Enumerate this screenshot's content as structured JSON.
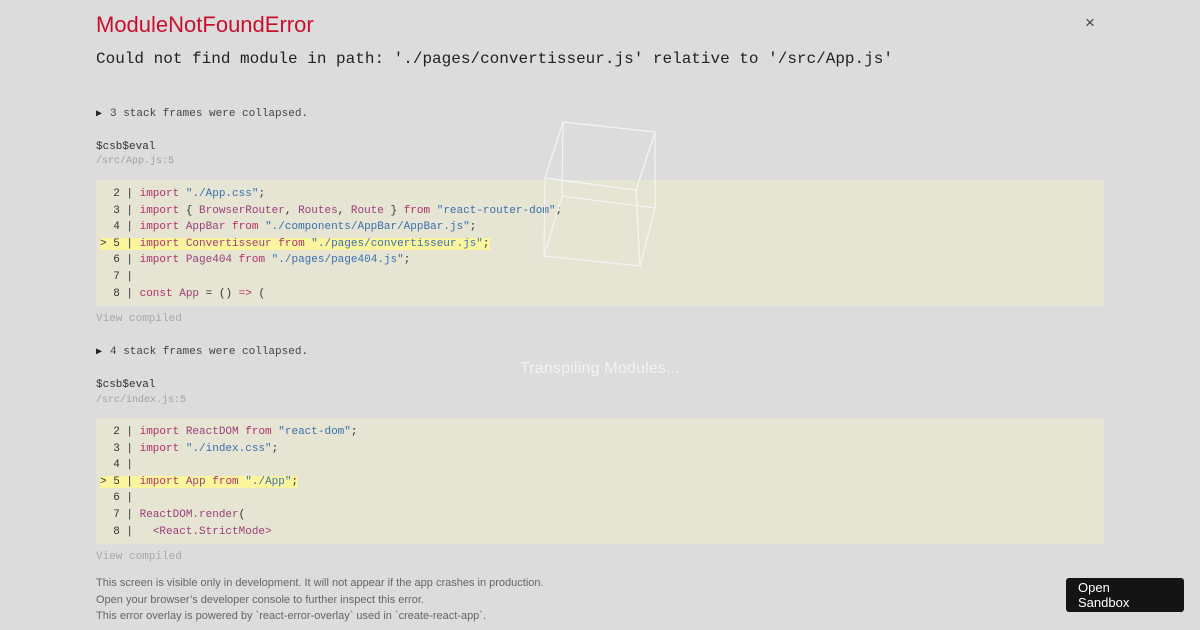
{
  "error": {
    "title": "ModuleNotFoundError",
    "message": "Could not find module in path: './pages/convertisseur.js' relative to '/src/App.js'",
    "close_label": "×"
  },
  "loading_text": "Transpiling Modules...",
  "stack": [
    {
      "collapsed_label": "3 stack frames were collapsed.",
      "function": "$csb$eval",
      "location": "/src/App.js:5",
      "view_compiled": "View compiled",
      "code_lines": [
        "  2 | import \"./App.css\";",
        "  3 | import { BrowserRouter, Routes, Route } from \"react-router-dom\";",
        "  4 | import AppBar from \"./components/AppBar/AppBar.js\";",
        "> 5 | import Convertisseur from \"./pages/convertisseur.js\";",
        "  6 | import Page404 from \"./pages/page404.js\";",
        "  7 |",
        "  8 | const App = () => ("
      ]
    },
    {
      "collapsed_label": "4 stack frames were collapsed.",
      "function": "$csb$eval",
      "location": "/src/index.js:5",
      "view_compiled": "View compiled",
      "code_lines": [
        "  2 | import ReactDOM from \"react-dom\";",
        "  3 | import \"./index.css\";",
        "  4 |",
        "> 5 | import App from \"./App\";",
        "  6 |",
        "  7 | ReactDOM.render(",
        "  8 |   <React.StrictMode>"
      ]
    }
  ],
  "footer": {
    "line1": "This screen is visible only in development. It will not appear if the app crashes in production.",
    "line2": "Open your browser’s developer console to further inspect this error.",
    "line3": "This error overlay is powered by `react-error-overlay` used in `create-react-app`."
  },
  "sandbox_button": {
    "line1": "Open",
    "line2": "Sandbox"
  },
  "colors": {
    "error": "#c8102e",
    "code_bg": "#e6e4d2",
    "highlight": "#fbf59e",
    "page_bg": "#dcdcdc"
  }
}
